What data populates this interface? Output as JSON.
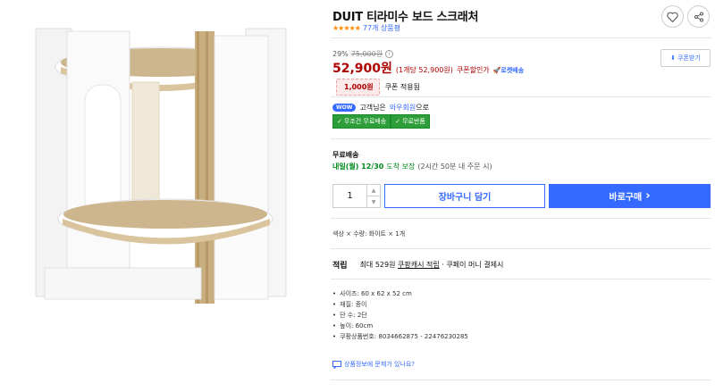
{
  "product": {
    "title": "DUIT 티라미수 보드 스크래처",
    "stars": "★★★★★",
    "review_count": "77개 상품평",
    "rating": 5
  },
  "price": {
    "discount_rate": "29%",
    "original_price": "75,000원",
    "info_icon": "i",
    "sale_price": "52,900원",
    "unit_price": "(1개당 52,900원)",
    "coupon_price": "쿠폰할인가",
    "rocket_label": "로켓배송",
    "coupon_button": "쿠폰받기"
  },
  "coupon": {
    "amount": "1,000원",
    "applied_text": "쿠폰 적용됨"
  },
  "wow": {
    "badge": "WOW",
    "prefix": "고객님은",
    "link": "와우회원",
    "suffix": "으로",
    "tags": [
      "무조건 무료배송",
      "무료반품"
    ]
  },
  "shipping": {
    "label": "무료배송",
    "date_strong": "내일(월) 12/30",
    "date_text": "도착 보장",
    "note": "(2시간 50분 내 주문 시)"
  },
  "purchase": {
    "quantity": "1",
    "cart_label": "장바구니 담기",
    "buy_label": "바로구매",
    "buy_arrow": "›"
  },
  "option": {
    "text": "색상 × 수량: 화이트 × 1개"
  },
  "reward": {
    "label": "적립",
    "text": "최대 529원",
    "link": "쿠팡캐시 적립",
    "rest": "· 쿠페이 머니 결제시"
  },
  "specs": [
    "사이즈: 60 x 62 x 52 cm",
    "재질: 종이",
    "단 수: 2단",
    "높이: 60cm",
    "쿠팡상품번호: 8034662875 - 22476230285"
  ],
  "report": {
    "text": "상품정보에 문제가 있나요?"
  },
  "colors": {
    "accent": "#346aff",
    "price_red": "#ae0000",
    "green": "#00891a",
    "tag_green": "#2e9e3a"
  }
}
